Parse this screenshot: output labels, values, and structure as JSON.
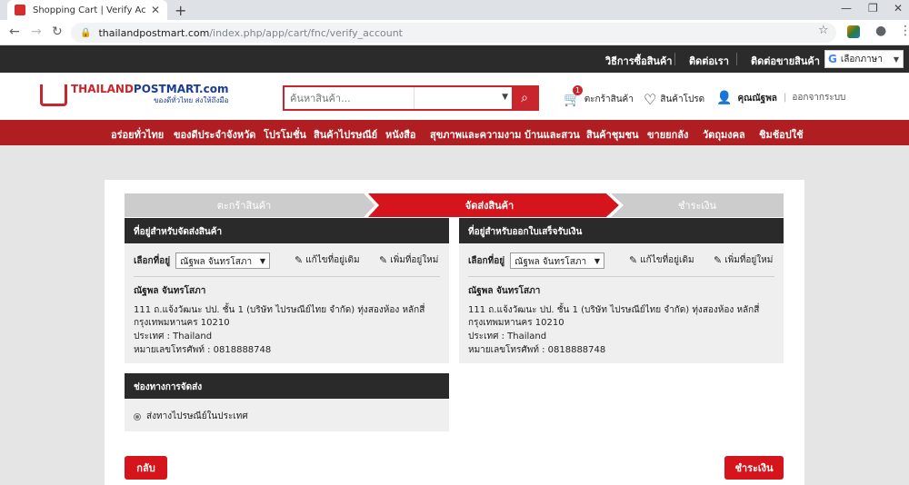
{
  "browser": {
    "tab_title": "Shopping Cart | Verify Account |",
    "url_host": "thailandpostmart.com",
    "url_path": "/index.php/app/cart/fnc/verify_account"
  },
  "top_links": [
    "วิธีการซื้อสินค้า",
    "ติดต่อเรา",
    "ติดต่อขายสินค้า"
  ],
  "translate_label": "เลือกภาษา",
  "logo": {
    "main_red": "THAILAND",
    "main_blue": "POSTMART.com",
    "tagline": "ของดีทั่วไทย ส่งให้ถึงมือ"
  },
  "search": {
    "placeholder": "ค้นหาสินค้า..."
  },
  "header_actions": {
    "cart_count": "1",
    "cart_label": "ตะกร้าสินค้า",
    "wishlist_label": "สินค้าโปรด",
    "user_name": "คุณณัฐพล",
    "logout_label": "ออกจากระบบ"
  },
  "categories": [
    "อร่อยทั่วไทย",
    "ของดีประจำจังหวัด",
    "โปรโมชั่น",
    "สินค้าไปรษณีย์",
    "หนังสือ",
    "สุขภาพและความงาม",
    "บ้านและสวน",
    "สินค้าชุมชน",
    "ขายยกลัง",
    "วัตถุมงคล",
    "ชิมช้อปใช้"
  ],
  "steps": [
    "ตะกร้าสินค้า",
    "จัดส่งสินค้า",
    "ชำระเงิน"
  ],
  "shipping_card": {
    "title": "ที่อยู่สำหรับจัดส่งสินค้า",
    "select_label": "เลือกที่อยู่",
    "select_value": "ณัฐพล จันทรโสภา",
    "edit_label": "แก้ไขที่อยู่เดิม",
    "add_label": "เพิ่มที่อยู่ใหม่",
    "name": "ณัฐพล จันทรโสภา",
    "address_line1": "111 ถ.แจ้งวัฒนะ ปป. ชั้น 1 (บริษัท ไปรษณีย์ไทย จำกัด) ทุ่งสองห้อง หลักสี่",
    "address_line2": "กรุงเทพมหานคร 10210",
    "country": "ประเทศ : Thailand",
    "phone": "หมายเลขโทรศัพท์ : 0818888748"
  },
  "billing_card": {
    "title": "ที่อยู่สำหรับออกใบเสร็จรับเงิน",
    "select_label": "เลือกที่อยู่",
    "select_value": "ณัฐพล จันทรโสภา",
    "edit_label": "แก้ไขที่อยู่เดิม",
    "add_label": "เพิ่มที่อยู่ใหม่",
    "name": "ณัฐพล จันทรโสภา",
    "address_line1": "111 ถ.แจ้งวัฒนะ ปป. ชั้น 1 (บริษัท ไปรษณีย์ไทย จำกัด) ทุ่งสองห้อง หลักสี่",
    "address_line2": "กรุงเทพมหานคร 10210",
    "country": "ประเทศ : Thailand",
    "phone": "หมายเลขโทรศัพท์ : 0818888748"
  },
  "delivery_card": {
    "title": "ช่องทางการจัดส่ง",
    "option": "ส่งทางไปรษณีย์ในประเทศ"
  },
  "buttons": {
    "back": "กลับ",
    "pay": "ชำระเงิน"
  },
  "colors": {
    "brand_red": "#c9252c",
    "nav_red": "#b01e22",
    "active_step": "#d5141c",
    "inactive_step": "#cccccc",
    "dark_header": "#2a2a2a"
  }
}
